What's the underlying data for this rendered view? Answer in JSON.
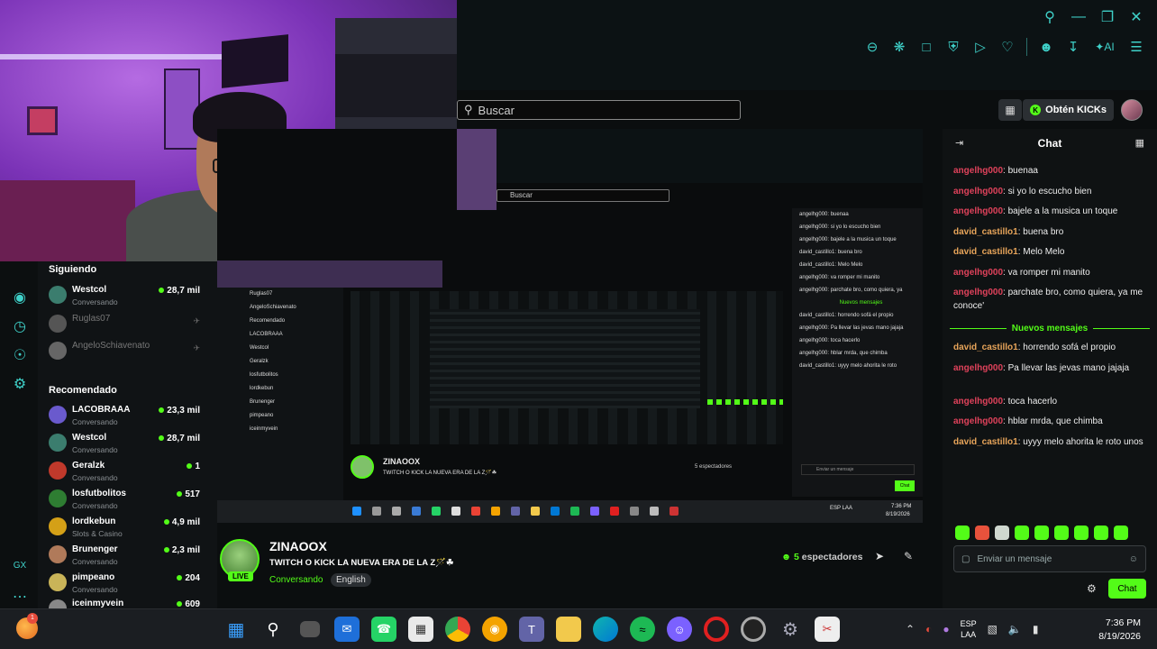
{
  "search": {
    "placeholder": "Buscar"
  },
  "header": {
    "kicks_label": "Obtén KICKs"
  },
  "chat": {
    "title": "Chat",
    "new_messages_label": "Nuevos mensajes",
    "input_placeholder": "Enviar un mensaje",
    "send_label": "Chat",
    "messages_before": [
      {
        "user": "angelhg000",
        "text": ": buenaa",
        "color": "#e0425b"
      },
      {
        "user": "angelhg000",
        "text": ": si yo lo escucho bien",
        "color": "#e0425b"
      },
      {
        "user": "angelhg000",
        "text": ": bajele a la musica un toque",
        "color": "#e0425b"
      },
      {
        "user": "david_castillo1",
        "text": ": buena bro",
        "color": "#e8a55a"
      },
      {
        "user": "david_castillo1",
        "text": ": Melo Melo",
        "color": "#e8a55a"
      },
      {
        "user": "angelhg000",
        "text": ": va romper mi manito",
        "color": "#e0425b"
      },
      {
        "user": "angelhg000",
        "text": ": parchate bro, como quiera, ya me conoce'",
        "color": "#e0425b"
      }
    ],
    "messages_after": [
      {
        "user": "david_castillo1",
        "text": ": horrendo sofá el propio",
        "color": "#e8a55a"
      },
      {
        "user": "angelhg000",
        "text": ": Pa llevar las jevas mano jajaja",
        "color": "#e0425b"
      },
      {
        "user": "angelhg000",
        "text": ": toca hacerlo",
        "color": "#e0425b"
      },
      {
        "user": "angelhg000",
        "text": ": hblar mrda, que chimba",
        "color": "#e0425b"
      },
      {
        "user": "david_castillo1",
        "text": ": uyyy melo ahorita le roto unos",
        "color": "#e8a55a"
      }
    ]
  },
  "sidebar": {
    "following_title": "Siguiendo",
    "recommended_title": "Recomendado",
    "following": [
      {
        "name": "Westcol",
        "sub": "Conversando",
        "viewers": "28,7 mil",
        "online": true,
        "avatar": "#3b7d6e"
      },
      {
        "name": "Ruglas07",
        "sub": "",
        "viewers": "",
        "online": false,
        "avatar": "#555"
      },
      {
        "name": "AngeloSchiavenato",
        "sub": "",
        "viewers": "",
        "online": false,
        "avatar": "#666"
      }
    ],
    "recommended": [
      {
        "name": "LACOBRAAA",
        "sub": "Conversando",
        "viewers": "23,3 mil",
        "avatar": "#6a5acd"
      },
      {
        "name": "Westcol",
        "sub": "Conversando",
        "viewers": "28,7 mil",
        "avatar": "#3b7d6e"
      },
      {
        "name": "Geralzk",
        "sub": "Conversando",
        "viewers": "1",
        "avatar": "#c0392b"
      },
      {
        "name": "losfutbolitos",
        "sub": "Conversando",
        "viewers": "517",
        "avatar": "#2e7d32"
      },
      {
        "name": "lordkebun",
        "sub": "Slots & Casino",
        "viewers": "4,9 mil",
        "avatar": "#d4a017"
      },
      {
        "name": "Brunenger",
        "sub": "Conversando",
        "viewers": "2,3 mil",
        "avatar": "#b07a5a"
      },
      {
        "name": "pimpeano",
        "sub": "Conversando",
        "viewers": "204",
        "avatar": "#c9b458"
      },
      {
        "name": "iceinmyvein",
        "sub": "",
        "viewers": "609",
        "avatar": "#888"
      }
    ]
  },
  "stream": {
    "name": "ZINAOOX",
    "title": "TWITCH O KICK LA NUEVA ERA DE LA Z🪄☘",
    "category": "Conversando",
    "tag": "English",
    "viewers_count": "5",
    "viewers_label": " espectadores",
    "live_label": "LIVE"
  },
  "nested": {
    "search": "Buscar",
    "chat_lines": [
      "angelhg000: buenaa",
      "angelhg000: si yo lo escucho bien",
      "angelhg000: bajele a la musica un toque",
      "david_castillo1: buena bro",
      "david_castillo1: Melo Melo",
      "angelhg000: va romper mi manito",
      "angelhg000: parchate bro, como quiera, ya",
      "Nuevos mensajes",
      "david_castillo1: horrendo sofá el propio",
      "angelhg000: Pa llevar las jevas mano jajaja",
      "angelhg000: toca hacerlo",
      "angelhg000: hblar mrda, que chimba",
      "david_castillo1: uyyy melo ahorita le roto"
    ],
    "side_lines": [
      "Siguiendo",
      "Westcol",
      "Ruglas07",
      "AngeloSchiavenato",
      "Recomendado",
      "LACOBRAAA",
      "Westcol",
      "Geralzk",
      "losfutbolitos",
      "lordkebun",
      "Brunenger",
      "pimpeano",
      "iceinmyvein"
    ],
    "stream_name": "ZINAOOX",
    "stream_title": "TWITCH O KICK LA NUEVA ERA DE LA Z🪄☘",
    "viewers": "5 espectadores",
    "input": "Enviar un mensaje",
    "send": "Chat",
    "lang": "ESP LAA",
    "time": "7:36 PM",
    "date": "8/19/2026"
  },
  "taskbar": {
    "badge_count": "1",
    "lang_top": "ESP",
    "lang_bottom": "LAA",
    "time": "7:36 PM",
    "date": "8/19/2026"
  }
}
